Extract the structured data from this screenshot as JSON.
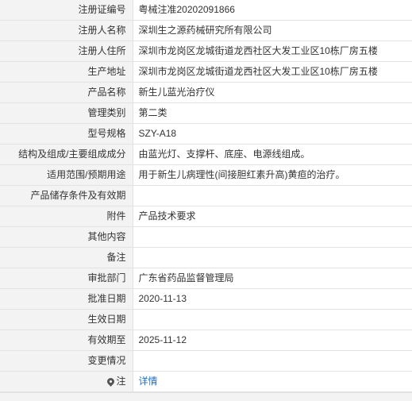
{
  "fields": [
    {
      "label": "注册证编号",
      "value": "粤械注准20202091866"
    },
    {
      "label": "注册人名称",
      "value": "深圳生之源药械研究所有限公司"
    },
    {
      "label": "注册人住所",
      "value": "深圳市龙岗区龙城街道龙西社区大发工业区10栋厂房五楼"
    },
    {
      "label": "生产地址",
      "value": "深圳市龙岗区龙城街道龙西社区大发工业区10栋厂房五楼"
    },
    {
      "label": "产品名称",
      "value": "新生儿蓝光治疗仪"
    },
    {
      "label": "管理类别",
      "value": "第二类"
    },
    {
      "label": "型号规格",
      "value": "SZY-A18"
    },
    {
      "label": "结构及组成/主要组成成分",
      "value": "由蓝光灯、支撑杆、底座、电源线组成。"
    },
    {
      "label": "适用范围/预期用途",
      "value": "用于新生儿病理性(间接胆红素升高)黄疸的治疗。"
    },
    {
      "label": "产品储存条件及有效期",
      "value": ""
    },
    {
      "label": "附件",
      "value": "产品技术要求"
    },
    {
      "label": "其他内容",
      "value": ""
    },
    {
      "label": "备注",
      "value": ""
    },
    {
      "label": "审批部门",
      "value": "广东省药品监督管理局"
    },
    {
      "label": "批准日期",
      "value": "2020-11-13"
    },
    {
      "label": "生效日期",
      "value": ""
    },
    {
      "label": "有效期至",
      "value": "2025-11-12"
    },
    {
      "label": "变更情况",
      "value": ""
    }
  ],
  "note_row": {
    "label": "注",
    "icon": "map-pin-icon",
    "link_text": "详情",
    "link_color": "#2a6ebb"
  }
}
